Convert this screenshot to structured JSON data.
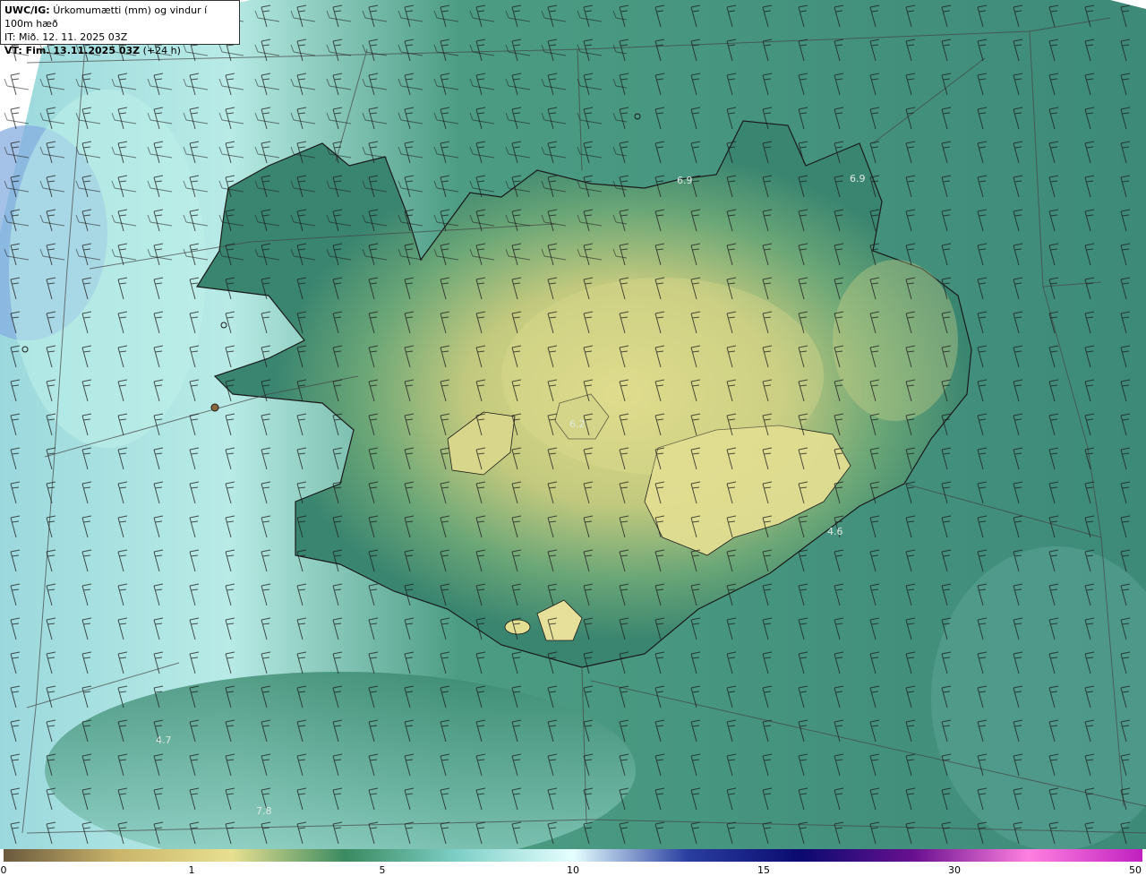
{
  "header": {
    "product_code": "UWC/IG:",
    "product_title": "Úrkomumætti (mm) og vindur í 100m hæð",
    "init_time": "IT: Mið. 12. 11. 2025 03Z",
    "valid_prefix": "VT: Fim. 13.11.2025 03Z",
    "valid_lead": "(+24 h)"
  },
  "map_labels": [
    {
      "id": "label-1",
      "text": "6.9"
    },
    {
      "id": "label-2",
      "text": "6.9"
    },
    {
      "id": "label-3",
      "text": "6.2"
    },
    {
      "id": "label-4",
      "text": "4.6"
    },
    {
      "id": "label-5",
      "text": "4.7"
    },
    {
      "id": "label-6",
      "text": "7.8"
    }
  ],
  "colorbar": {
    "ticks": [
      "0",
      "1",
      "5",
      "10",
      "15",
      "30",
      "50"
    ],
    "colors": [
      "#6b5a3e",
      "#c9b46a",
      "#e8e090",
      "#3a8a60",
      "#7fd0c8",
      "#e6ffff",
      "#2a3fa0",
      "#0a0a70",
      "#6a1090",
      "#ff80e0",
      "#c020c0"
    ]
  },
  "colors": {
    "ocean_dark": "#2f7f73",
    "ocean_light": "#bfeee9",
    "land_low": "#3f8c66",
    "land_high": "#d8d88a",
    "far_west": "#7fa6d8"
  }
}
